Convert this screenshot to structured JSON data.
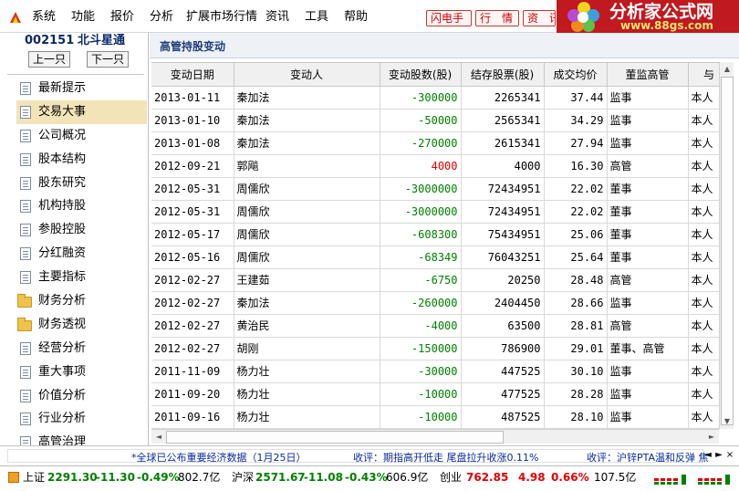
{
  "menubar": {
    "items": [
      "系统",
      "功能",
      "报价",
      "分析",
      "扩展市场行情",
      "资讯",
      "工具",
      "帮助"
    ],
    "tags": [
      "闪电手",
      "行　情",
      "资　讯"
    ]
  },
  "logo": {
    "title": "分析家公式网",
    "url": "www.88gs.com"
  },
  "stock": {
    "code": "002151",
    "name": "北斗星通",
    "prev": "上一只",
    "next": "下一只"
  },
  "sidebar": {
    "items": [
      {
        "label": "最新提示",
        "icon": "doc"
      },
      {
        "label": "交易大事",
        "icon": "doc",
        "active": true
      },
      {
        "label": "公司概况",
        "icon": "doc"
      },
      {
        "label": "股本结构",
        "icon": "doc"
      },
      {
        "label": "股东研究",
        "icon": "doc"
      },
      {
        "label": "机构持股",
        "icon": "doc"
      },
      {
        "label": "参股控股",
        "icon": "doc"
      },
      {
        "label": "分红融资",
        "icon": "doc"
      },
      {
        "label": "主要指标",
        "icon": "doc"
      },
      {
        "label": "财务分析",
        "icon": "folder"
      },
      {
        "label": "财务透视",
        "icon": "folder"
      },
      {
        "label": "经营分析",
        "icon": "doc"
      },
      {
        "label": "重大事项",
        "icon": "doc"
      },
      {
        "label": "价值分析",
        "icon": "doc"
      },
      {
        "label": "行业分析",
        "icon": "doc"
      },
      {
        "label": "高管治理",
        "icon": "doc"
      }
    ]
  },
  "panel": {
    "title": "高管持股变动"
  },
  "table": {
    "headers": [
      "变动日期",
      "变动人",
      "变动股数(股)",
      "结存股票(股)",
      "成交均价",
      "董监高管",
      "与"
    ],
    "rows": [
      [
        "2013-01-11",
        "秦加法",
        "-300000",
        "2265341",
        "37.44",
        "监事",
        "本人"
      ],
      [
        "2013-01-10",
        "秦加法",
        "-50000",
        "2565341",
        "34.29",
        "监事",
        "本人"
      ],
      [
        "2013-01-08",
        "秦加法",
        "-270000",
        "2615341",
        "27.94",
        "监事",
        "本人"
      ],
      [
        "2012-09-21",
        "郭飚",
        "4000",
        "4000",
        "16.30",
        "高管",
        "本人"
      ],
      [
        "2012-05-31",
        "周儒欣",
        "-3000000",
        "72434951",
        "22.02",
        "董事",
        "本人"
      ],
      [
        "2012-05-31",
        "周儒欣",
        "-3000000",
        "72434951",
        "22.02",
        "董事",
        "本人"
      ],
      [
        "2012-05-17",
        "周儒欣",
        "-608300",
        "75434951",
        "25.06",
        "董事",
        "本人"
      ],
      [
        "2012-05-16",
        "周儒欣",
        "-68349",
        "76043251",
        "25.64",
        "董事",
        "本人"
      ],
      [
        "2012-02-27",
        "王建茹",
        "-6750",
        "20250",
        "28.48",
        "高管",
        "本人"
      ],
      [
        "2012-02-27",
        "秦加法",
        "-260000",
        "2404450",
        "28.66",
        "监事",
        "本人"
      ],
      [
        "2012-02-27",
        "黄治民",
        "-4000",
        "63500",
        "28.81",
        "高管",
        "本人"
      ],
      [
        "2012-02-27",
        "胡刚",
        "-150000",
        "786900",
        "29.01",
        "董事、高管",
        "本人"
      ],
      [
        "2011-11-09",
        "杨力壮",
        "-30000",
        "447525",
        "30.10",
        "监事",
        "本人"
      ],
      [
        "2011-09-20",
        "杨力壮",
        "-10000",
        "477525",
        "28.28",
        "监事",
        "本人"
      ],
      [
        "2011-09-16",
        "杨力壮",
        "-10000",
        "487525",
        "28.10",
        "监事",
        "本人"
      ]
    ]
  },
  "ticker": {
    "items": [
      "*全球已公布重要经济数据（1月25日）",
      "收评：期指高开低走 尾盘拉升收涨0.11%",
      "收评：沪锌PTA温和反弹 焦"
    ],
    "controls": [
      "◄",
      "►",
      "×"
    ]
  },
  "status": {
    "sh_label": "上证",
    "sh_price": "2291.30",
    "sh_change": "-11.30",
    "sh_pct": "-0.49%",
    "sh_amount": "802.7亿",
    "sz_label": "沪深",
    "sz_price": "2571.67",
    "sz_change": "-11.08",
    "sz_pct": "-0.43%",
    "sz_amount": "606.9亿",
    "cy_label": "创业",
    "cy_price": "762.85",
    "cy_change": "4.98",
    "cy_pct": "0.66%",
    "cy_amount": "107.5亿"
  },
  "colors": {
    "negative": "#008000",
    "positive": "#e00000",
    "logo_bg": "#c0191f",
    "active_item": "#f2e4b8"
  }
}
